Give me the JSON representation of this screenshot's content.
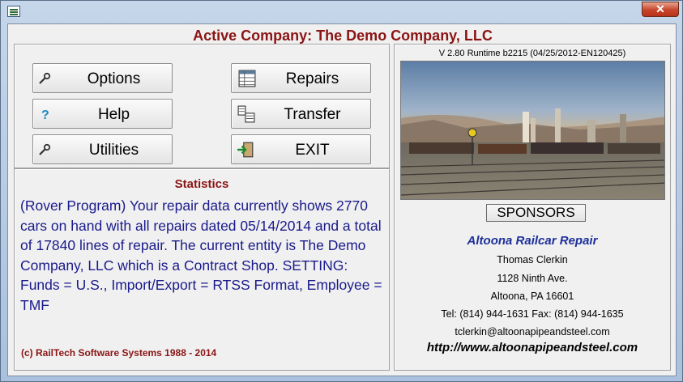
{
  "window": {
    "close_glyph": "✕"
  },
  "header": {
    "title": "Active Company: The Demo Company, LLC"
  },
  "buttons": {
    "options": {
      "label": "Options",
      "icon": "wrench-icon"
    },
    "help": {
      "label": "Help",
      "icon": "question-icon"
    },
    "utilities": {
      "label": "Utilities",
      "icon": "wrench-icon"
    },
    "repairs": {
      "label": "Repairs",
      "icon": "spreadsheet-icon"
    },
    "transfer": {
      "label": "Transfer",
      "icon": "transfer-icon"
    },
    "exit": {
      "label": "EXIT",
      "icon": "exit-door-icon"
    }
  },
  "stats": {
    "heading": "Statistics",
    "body": "(Rover Program)  Your repair data currently shows 2770 cars on hand with all repairs dated 05/14/2014 and a total of 17840 lines of repair.    The current entity is The Demo Company, LLC which is a Contract Shop.  SETTING:  Funds = U.S., Import/Export = RTSS Format,   Employee = TMF",
    "copyright": "(c) RailTech Software Systems 1988 - 2014"
  },
  "version": "V 2.80 Runtime  b2215 (04/25/2012-EN120425)",
  "sponsors": {
    "button_label": "SPONSORS",
    "name": "Altoona Railcar Repair",
    "contact": "Thomas Clerkin",
    "address1": "1128 Ninth Ave.",
    "address2": "Altoona, PA 16601",
    "phone": "Tel: (814) 944-1631 Fax: (814) 944-1635",
    "email": "tclerkin@altoonapipeandsteel.com",
    "website": "http://www.altoonapipeandsteel.com"
  },
  "colors": {
    "title_red": "#8b1414",
    "stats_blue": "#1a1a8c",
    "sponsor_blue": "#1c2f9a"
  }
}
